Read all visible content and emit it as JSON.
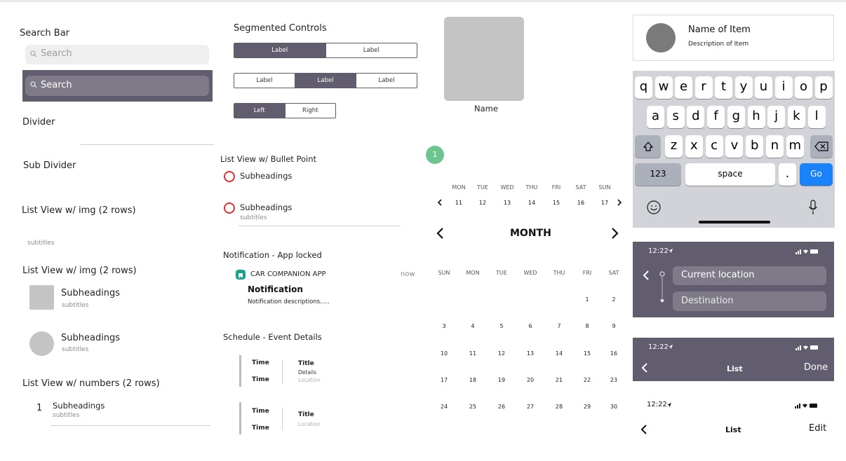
{
  "col1": {
    "search_bar_title": "Search Bar",
    "search_placeholder": "Search",
    "search_dark_placeholder": "Search",
    "divider_title": "Divider",
    "sub_divider_title": "Sub Divider",
    "list_img_title": "List View w/ img (2 rows)",
    "list_img_subtitle": "subtitles",
    "list_img2_title": "List View w/ img (2 rows)",
    "list_items": [
      {
        "heading": "Subheadings",
        "subtitle": "subtitles"
      },
      {
        "heading": "Subheadings",
        "subtitle": "subtitles"
      }
    ],
    "list_numbers_title": "List View w/ numbers (2 rows)",
    "number_item": {
      "number": "1",
      "heading": "Subheadings",
      "subtitle": "subtitles"
    }
  },
  "col2": {
    "segmented_title": "Segmented Controls",
    "seg1": [
      "Label",
      "Label"
    ],
    "seg2": [
      "Label",
      "Label",
      "Label"
    ],
    "seg3": [
      "Left",
      "Right"
    ],
    "bullet_title": "List View w/ Bullet Point",
    "bullet_items": [
      {
        "heading": "Subheadings",
        "subtitle": ""
      },
      {
        "heading": "Subheadings",
        "subtitle": "subtitles"
      }
    ],
    "notif_title": "Notification - App locked",
    "notif_app": "CAR COMPANION APP",
    "notif_time": "now",
    "notif_heading": "Notification",
    "notif_desc": "Notification descriptions.....",
    "schedule_title": "Schedule - Event Details",
    "events": [
      {
        "time1": "Time",
        "time2": "Time",
        "title": "Title",
        "details": "Details",
        "location": "Location"
      },
      {
        "time1": "Time",
        "time2": "Time",
        "title": "Title",
        "details": "",
        "location": "Location"
      }
    ]
  },
  "col3": {
    "card_name": "Name",
    "badge": "1",
    "week_days": [
      "MON",
      "TUE",
      "WED",
      "THU",
      "FRI",
      "SAT",
      "SUN"
    ],
    "week_dates": [
      "11",
      "12",
      "13",
      "14",
      "15",
      "16",
      "17"
    ],
    "month_label": "MONTH",
    "month_days": [
      "SUN",
      "MON",
      "TUE",
      "WED",
      "THU",
      "FRI",
      "SAT"
    ],
    "month_rows": [
      [
        "",
        "",
        "",
        "",
        "",
        "1",
        "2"
      ],
      [
        "3",
        "4",
        "5",
        "6",
        "7",
        "8",
        "9"
      ],
      [
        "10",
        "11",
        "12",
        "13",
        "14",
        "15",
        "16"
      ],
      [
        "17",
        "18",
        "19",
        "20",
        "21",
        "22",
        "23"
      ],
      [
        "24",
        "25",
        "26",
        "27",
        "28",
        "29",
        "30"
      ]
    ]
  },
  "col4": {
    "item_name": "Name of Item",
    "item_desc": "Description of Item",
    "kb_row1": [
      "q",
      "w",
      "e",
      "r",
      "t",
      "y",
      "u",
      "i",
      "o",
      "p"
    ],
    "kb_row2": [
      "a",
      "s",
      "d",
      "f",
      "g",
      "h",
      "j",
      "k",
      "l"
    ],
    "kb_row3": [
      "z",
      "x",
      "c",
      "v",
      "b",
      "n",
      "m"
    ],
    "kb_123": "123",
    "kb_space": "space",
    "kb_dot": ".",
    "kb_go": "Go",
    "time": "12:22",
    "current_location": "Current location",
    "destination": "Destination",
    "nav_dark_title": "List",
    "nav_dark_action": "Done",
    "nav_light_title": "List",
    "nav_light_action": "Edit",
    "accent": "#1a82fb",
    "dark_bg": "#625d6e"
  }
}
